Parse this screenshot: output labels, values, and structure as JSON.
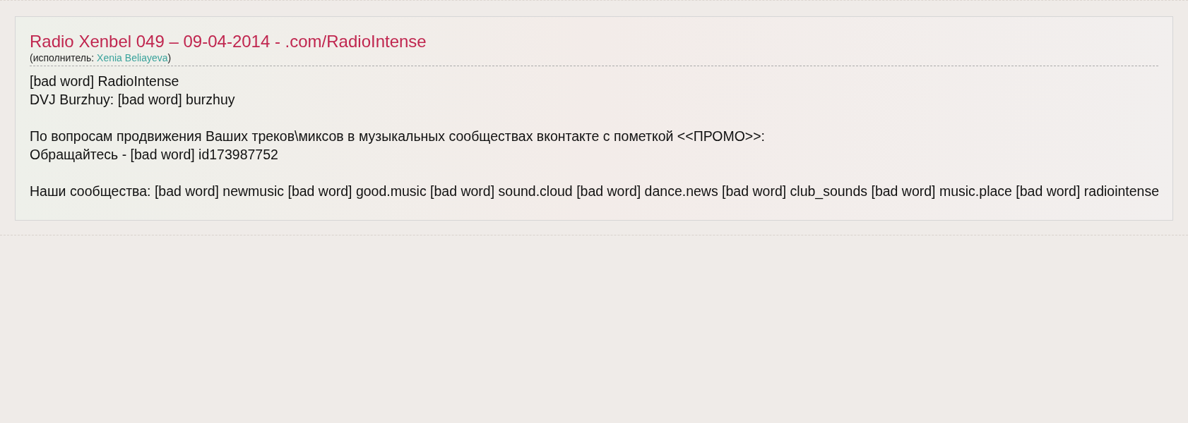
{
  "title": "Radio Xenbel 049 – 09-04-2014 - .com/RadioIntense",
  "performer": {
    "label": "(исполнитель:",
    "name": "Xenia Beliayeva",
    "close": ")"
  },
  "paragraphs": [
    [
      "[bad word] RadioIntense",
      "DVJ Burzhuy: [bad word] burzhuy"
    ],
    [
      "По вопросам продвижения Ваших треков\\миксов в музыкальных сообществах вконтакте с пометкой <<ПРОМО>>:",
      "Обращайтесь - [bad word] id173987752"
    ],
    [
      "Наши сообщества: [bad word] newmusic [bad word] good.music [bad word] sound.cloud [bad word] dance.news [bad word] club_sounds [bad word] music.place [bad word] radiointense"
    ]
  ]
}
